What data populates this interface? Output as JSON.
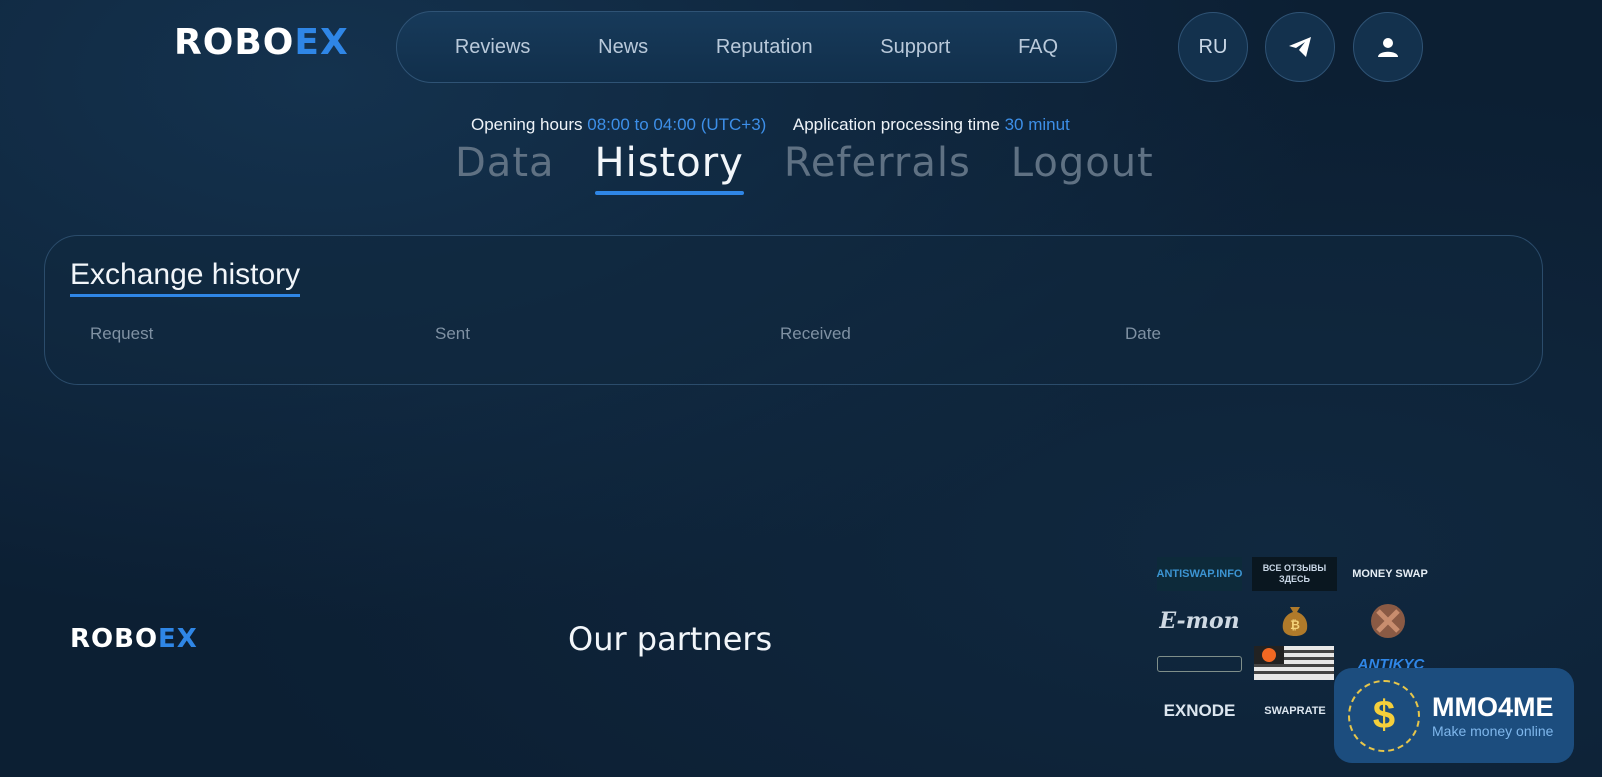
{
  "brand": {
    "logo_part1": "ROBO",
    "logo_part2": "EX"
  },
  "nav": {
    "items": [
      "Reviews",
      "News",
      "Reputation",
      "Support",
      "FAQ"
    ]
  },
  "header_buttons": {
    "language": "RU",
    "telegram_icon": "paper-plane-icon",
    "account_icon": "user-icon"
  },
  "info": {
    "hours_label": "Opening hours",
    "hours_value": "08:00 to 04:00 (UTC+3)",
    "processing_label": "Application processing time",
    "processing_value": "30 minut"
  },
  "tabs": [
    {
      "label": "Data",
      "active": false
    },
    {
      "label": "History",
      "active": true
    },
    {
      "label": "Referrals",
      "active": false
    },
    {
      "label": "Logout",
      "active": false
    }
  ],
  "history": {
    "title": "Exchange history",
    "columns": [
      "Request",
      "Sent",
      "Received",
      "Date"
    ]
  },
  "footer": {
    "partners_title": "Our partners",
    "partners": [
      "ANTISWAP.INFO",
      "ВСЕ ОТЗЫВЫ ЗДЕСЬ",
      "MONEY SWAP",
      "E-mon",
      "EXNODE",
      "SWAPRATE",
      "ANTIKYC"
    ]
  },
  "watermark": {
    "title": "MMO4ME",
    "subtitle": "Make money online"
  },
  "colors": {
    "accent": "#2f86e6",
    "background": "#0c1f33"
  }
}
